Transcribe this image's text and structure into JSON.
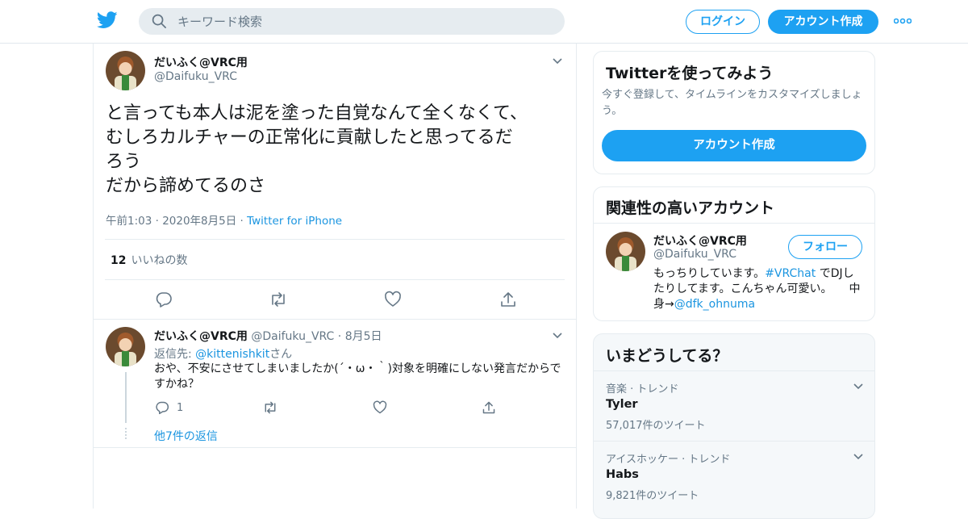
{
  "header": {
    "search_placeholder": "キーワード検索",
    "login_label": "ログイン",
    "signup_label": "アカウント作成"
  },
  "tweet": {
    "name": "だいふく@VRC用",
    "handle": "@Daifuku_VRC",
    "text": "と言っても本人は泥を塗った自覚なんて全くなくて、\nむしろカルチャーの正常化に貢献したと思ってるだ\nろう\nだから諦めてるのさ",
    "time": "午前1:03",
    "date": "2020年8月5日",
    "source": "Twitter for iPhone",
    "likes_count": "12",
    "likes_label": "いいねの数"
  },
  "reply": {
    "name": "だいふく@VRC用",
    "handle": "@Daifuku_VRC",
    "date": "8月5日",
    "replying_prefix": "返信先: ",
    "replying_to": "@kittenishkit",
    "replying_suffix": "さん",
    "text": "おや、不安にさせてしまいましたか(´・ω・｀)対象を明確にしない発言だからですかね？",
    "reply_count": "1",
    "more_replies": "他7件の返信"
  },
  "signup_card": {
    "title": "Twitterを使ってみよう",
    "description": "今すぐ登録して、タイムラインをカスタマイズしましょう。",
    "button": "アカウント作成"
  },
  "related_card": {
    "title": "関連性の高いアカウント",
    "name": "だいふく@VRC用",
    "handle": "@Daifuku_VRC",
    "follow_label": "フォロー",
    "bio_prefix": "もっちりしています。",
    "bio_hashtag": "#VRChat",
    "bio_middle": " でDJしたりしてます。こんちゃん可愛い。　　中身→",
    "bio_link": "@dfk_ohnuma"
  },
  "trends_card": {
    "title": "いまどうしてる？",
    "items": [
      {
        "context": "音楽 · トレンド",
        "name": "Tyler",
        "count": "57,017件のツイート"
      },
      {
        "context": "アイスホッケー · トレンド",
        "name": "Habs",
        "count": "9,821件のツイート"
      }
    ]
  },
  "colors": {
    "brand": "#1da1f2",
    "link": "#1b95e0",
    "muted": "#657786"
  },
  "icons": [
    "twitter-logo-icon",
    "search-icon",
    "more-icon",
    "chevron-down-icon",
    "reply-icon",
    "retweet-icon",
    "like-icon",
    "share-icon"
  ]
}
